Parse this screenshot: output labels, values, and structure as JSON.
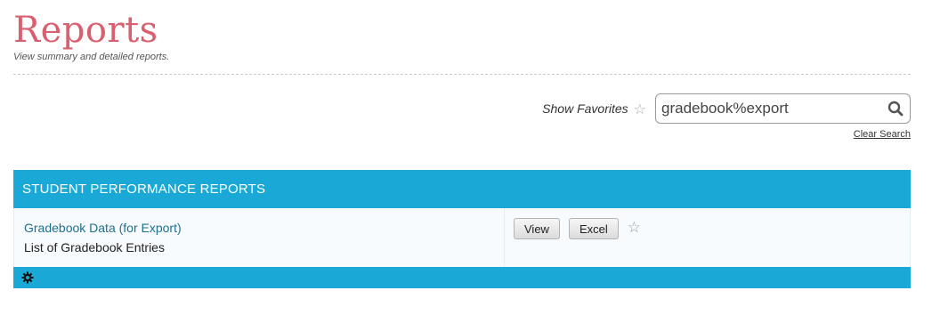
{
  "header": {
    "title": "Reports",
    "subtitle": "View summary and detailed reports."
  },
  "toolbar": {
    "favorites_label": "Show Favorites",
    "favorites_icon": "star-outline-icon",
    "search_value": "gradebook%export",
    "search_icon": "search-icon",
    "clear_search_label": "Clear Search"
  },
  "panel": {
    "header_label": "STUDENT PERFORMANCE REPORTS",
    "accent_color": "#1aa9d6",
    "reports": [
      {
        "name": "Gradebook Data (for Export)",
        "description": "List of Gradebook Entries",
        "view_label": "View",
        "excel_label": "Excel",
        "favorite_icon": "star-outline-icon"
      }
    ],
    "footer_icon": "gear-icon"
  },
  "colors": {
    "title": "#d9606f",
    "link": "#1f6f8b"
  }
}
